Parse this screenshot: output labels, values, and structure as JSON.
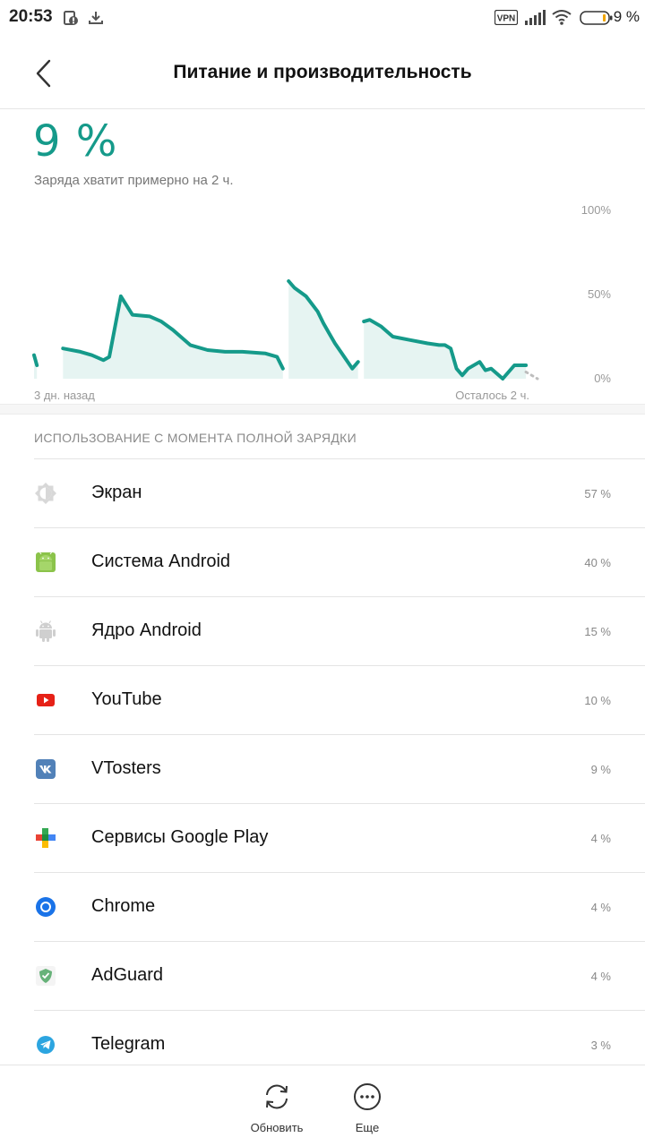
{
  "status_bar": {
    "time": "20:53",
    "battery_text": "9 %",
    "vpn_label": "VPN",
    "icons": [
      "data-saver-icon",
      "download-icon",
      "vpn-icon",
      "signal-icon",
      "wifi-icon",
      "battery-icon"
    ]
  },
  "header": {
    "title": "Питание и производительность",
    "back_icon": "chevron-left-icon"
  },
  "battery": {
    "level": "9 %",
    "estimate": "Заряда хватит примерно на 2 ч."
  },
  "chart_data": {
    "type": "area",
    "ylim": [
      0,
      100
    ],
    "y_ticks": [
      "100%",
      "50%",
      "0%"
    ],
    "x_start_label": "3 дн. назад",
    "x_end_label": "Осталось 2 ч.",
    "segments": [
      {
        "x": [
          0,
          0.5
        ],
        "y": [
          14,
          8
        ]
      },
      {
        "x": [
          5,
          8,
          10,
          12,
          13,
          15,
          17,
          20,
          22,
          24,
          27,
          30,
          33,
          36,
          40,
          42,
          43
        ],
        "y": [
          18,
          16,
          14,
          11,
          13,
          49,
          38,
          37,
          34,
          29,
          20,
          17,
          16,
          16,
          15,
          13,
          6
        ]
      },
      {
        "x": [
          44,
          45,
          47,
          49,
          50,
          51,
          52,
          55,
          56
        ],
        "y": [
          58,
          54,
          49,
          40,
          33,
          27,
          21,
          6,
          10
        ]
      },
      {
        "x": [
          57,
          58,
          60,
          62,
          65,
          68,
          70,
          71,
          72,
          73,
          74,
          75,
          77,
          78,
          79,
          81,
          83,
          85
        ],
        "y": [
          34,
          35,
          31,
          25,
          23,
          21,
          20,
          20,
          18,
          6,
          2,
          6,
          10,
          5,
          6,
          0,
          8,
          8
        ]
      }
    ],
    "forecast": {
      "x": [
        85,
        87
      ],
      "y": [
        4,
        0
      ]
    },
    "colors": {
      "line": "#159a8a",
      "fill": "#e6f4f2",
      "forecast": "#bdbdbd"
    }
  },
  "usage": {
    "section_title": "ИСПОЛЬЗОВАНИЕ С МОМЕНТА ПОЛНОЙ ЗАРЯДКИ",
    "items": [
      {
        "name": "Экран",
        "percent": "57 %",
        "icon": "brightness-icon"
      },
      {
        "name": "Система Android",
        "percent": "40 %",
        "icon": "android-icon"
      },
      {
        "name": "Ядро Android",
        "percent": "15 %",
        "icon": "android-gray-icon"
      },
      {
        "name": "YouTube",
        "percent": "10 %",
        "icon": "youtube-icon"
      },
      {
        "name": "VTosters",
        "percent": "9 %",
        "icon": "vk-icon"
      },
      {
        "name": "Сервисы Google Play",
        "percent": "4 %",
        "icon": "google-play-services-icon"
      },
      {
        "name": "Chrome",
        "percent": "4 %",
        "icon": "chrome-icon"
      },
      {
        "name": "AdGuard",
        "percent": "4 %",
        "icon": "adguard-icon"
      },
      {
        "name": "Telegram",
        "percent": "3 %",
        "icon": "telegram-icon"
      }
    ]
  },
  "bottom_bar": {
    "refresh_label": "Обновить",
    "more_label": "Еще"
  }
}
